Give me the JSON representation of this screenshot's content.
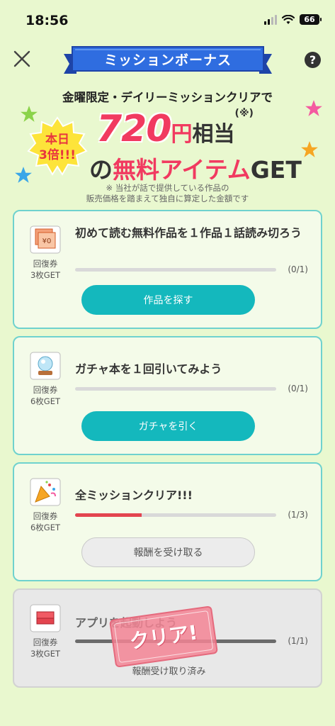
{
  "status": {
    "time": "18:56",
    "battery": "66"
  },
  "header": {
    "title": "ミッションボーナス",
    "help": "?"
  },
  "banner": {
    "subtitle": "金曜限定・デイリーミッションクリアで",
    "badge_line1": "本日",
    "badge_line2": "3倍!!!",
    "amount": "720",
    "yen": "円",
    "equiv": "相当",
    "note_mark": "(※)",
    "line2_no": "の",
    "line2_free": "無料アイテム",
    "line2_get": "GET",
    "disclaimer_line1": "※ 当社が話で提供している作品の",
    "disclaimer_line2": "販売価格を踏まえて独自に算定した金額です"
  },
  "missions": [
    {
      "icon": "coupon-icon",
      "reward_line1": "回復券",
      "reward_line2": "3枚GET",
      "title": "初めて読む無料作品を１作品１話読み切ろう",
      "progress": "(0/1)",
      "progress_value": 0,
      "button": "作品を探す"
    },
    {
      "icon": "crystal-ball-icon",
      "reward_line1": "回復券",
      "reward_line2": "6枚GET",
      "title": "ガチャ本を１回引いてみよう",
      "progress": "(0/1)",
      "progress_value": 0,
      "button": "ガチャを引く"
    },
    {
      "icon": "party-popper-icon",
      "reward_line1": "回復券",
      "reward_line2": "6枚GET",
      "title": "全ミッションクリア!!!",
      "progress": "(1/3)",
      "progress_value": 0.33,
      "button": "報酬を受け取る"
    },
    {
      "icon": "app-icon",
      "reward_line1": "回復券",
      "reward_line2": "3枚GET",
      "title": "アプリを起動しよう",
      "progress": "(1/1)",
      "progress_value": 1,
      "status": "報酬受け取り済み",
      "stamp": "クリア!"
    }
  ],
  "colors": {
    "accent": "#14b8bd",
    "pink": "#f13a60",
    "background": "#e9f8cf",
    "card_border": "#6fd2ce"
  }
}
